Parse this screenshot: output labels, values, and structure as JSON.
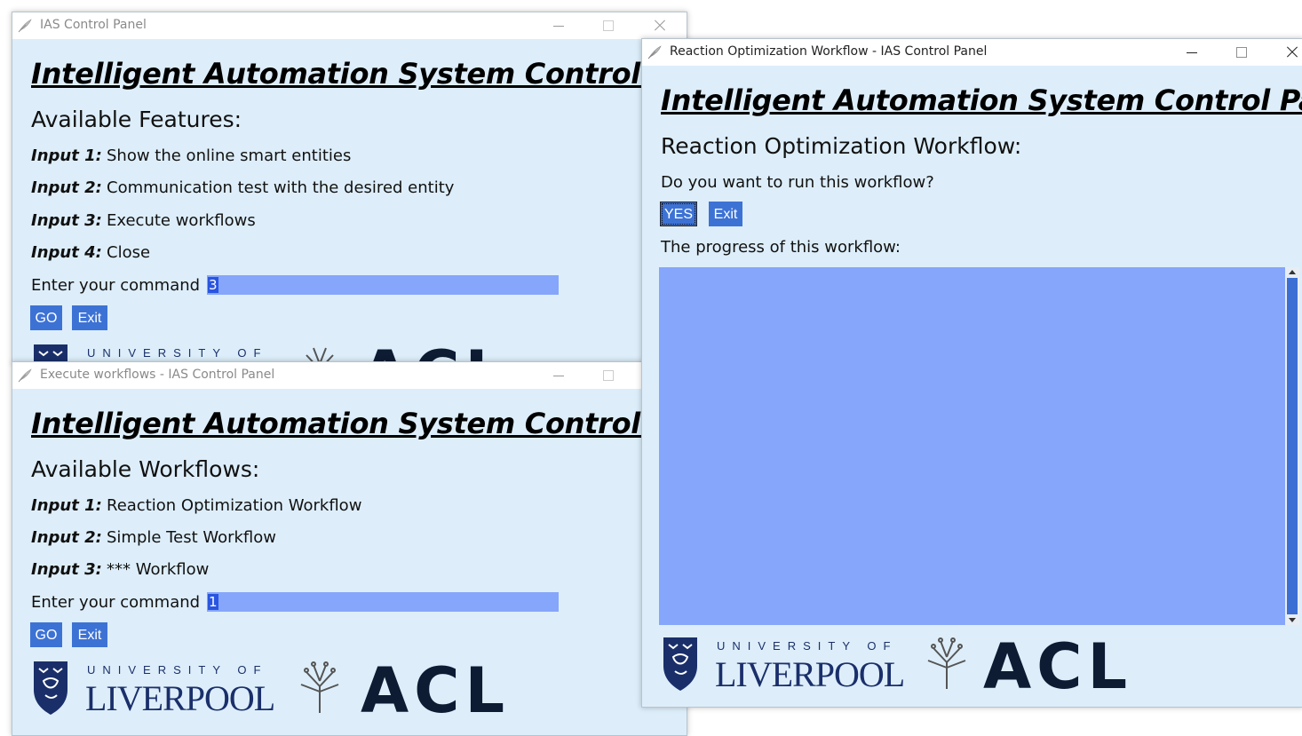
{
  "window_main": {
    "title": "IAS Control Panel",
    "heading": "Intelligent Automation System Control Panel",
    "section": "Available Features:",
    "items": [
      {
        "label": "Input 1:",
        "text": "Show the online smart entities"
      },
      {
        "label": "Input 2:",
        "text": "Communication test with the desired entity"
      },
      {
        "label": "Input 3:",
        "text": "Execute workflows"
      },
      {
        "label": "Input 4:",
        "text": "Close"
      }
    ],
    "command_label": "Enter your command",
    "command_value": "3",
    "go_label": "GO",
    "exit_label": "Exit"
  },
  "window_workflows": {
    "title": "Execute workflows - IAS Control Panel",
    "heading": "Intelligent Automation System Control Panel",
    "section": "Available Workflows:",
    "items": [
      {
        "label": "Input 1:",
        "text": "Reaction Optimization Workflow"
      },
      {
        "label": "Input 2:",
        "text": "Simple Test Workflow"
      },
      {
        "label": "Input 3:",
        "text": "*** Workflow"
      }
    ],
    "command_label": "Enter your command",
    "command_value": "1",
    "go_label": "GO",
    "exit_label": "Exit"
  },
  "window_reaction": {
    "title": "Reaction Optimization Workflow - IAS Control Panel",
    "heading": "Intelligent Automation System Control Panel",
    "section": "Reaction Optimization Workflow:",
    "question": "Do you want to run this workflow?",
    "yes_label": "YES",
    "exit_label": "Exit",
    "progress_label": "The progress of this workflow:",
    "progress_text": ""
  },
  "logos": {
    "university_top": "UNIVERSITY OF",
    "university_main": "LIVERPOOL",
    "acl": "ACL"
  },
  "colors": {
    "window_bg": "#ddeefa",
    "entry_bg": "#86a6fb",
    "button_bg": "#3d72d5",
    "navy": "#1a2f6a"
  }
}
